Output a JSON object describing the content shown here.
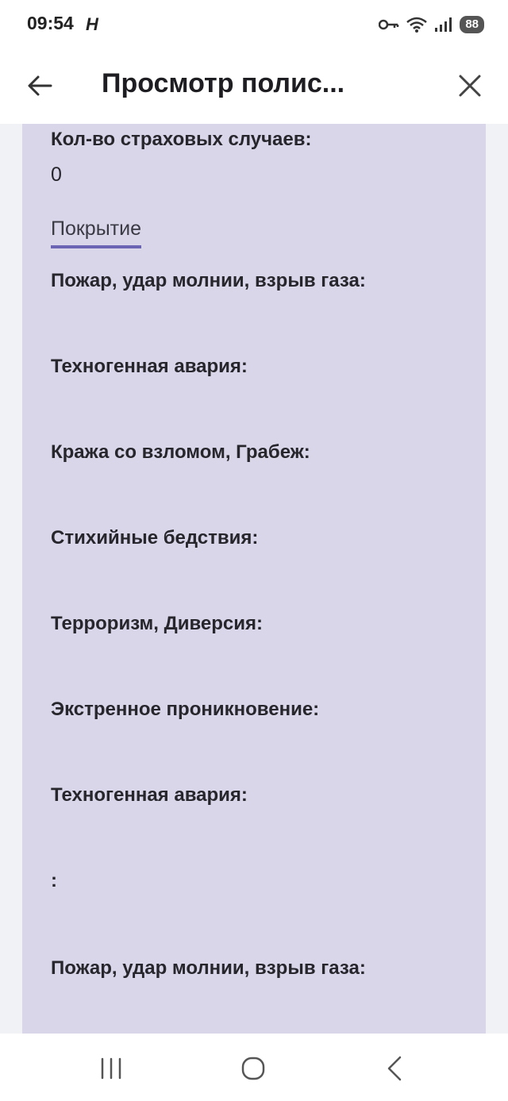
{
  "status_bar": {
    "time": "09:54",
    "app_icon": "H",
    "battery": "88",
    "icons": [
      "key-icon",
      "wifi-icon",
      "signal-icon"
    ]
  },
  "header": {
    "title": "Просмотр полис...",
    "back_icon": "arrow-left-icon",
    "close_icon": "close-icon"
  },
  "card": {
    "claims_label": "Кол-во страховых случаев:",
    "claims_value": "0",
    "tab_label": "Покрытие",
    "coverage_items": [
      "Пожар, удар молнии, взрыв газа:",
      "Техногенная авария:",
      "Кража со взломом, Грабеж:",
      "Стихийные бедствия:",
      "Терроризм, Диверсия:",
      "Экстренное проникновение:",
      "Техногенная авария:",
      ":",
      "Пожар, удар молнии, взрыв газа:"
    ]
  },
  "nav_bar": {
    "buttons": [
      "recent-apps-icon",
      "home-icon",
      "back-icon"
    ]
  },
  "colors": {
    "card_bg": "#d9d6e9",
    "tab_underline": "#6b63b3",
    "page_bg": "#f1f2f5"
  }
}
